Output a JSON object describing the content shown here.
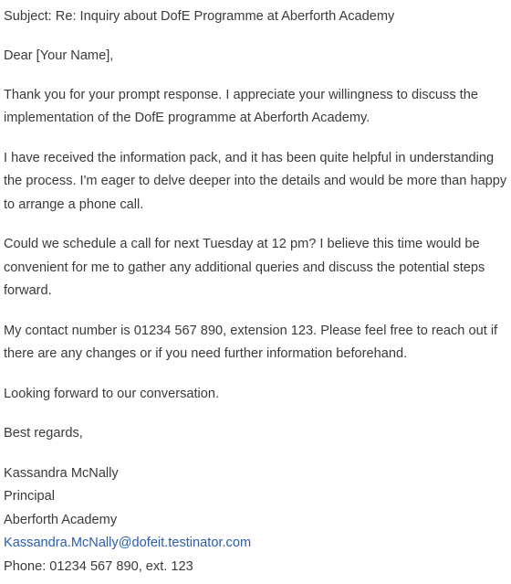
{
  "email": {
    "subject": "Subject: Re: Inquiry about DofE Programme at Aberforth Academy",
    "greeting": "Dear [Your Name],",
    "paragraphs": [
      "Thank you for your prompt response. I appreciate your willingness to discuss the implementation of the DofE programme at Aberforth Academy.",
      "I have received the information pack, and it has been quite helpful in understanding the process. I'm eager to delve deeper into the details and would be more than happy to arrange a phone call.",
      "Could we schedule a call for next Tuesday at 12 pm? I believe this time would be convenient for me to gather any additional queries and discuss the potential steps forward.",
      "My contact number is 01234 567 890, extension 123. Please feel free to reach out if there are any changes or if you need further information beforehand.",
      "Looking forward to our conversation."
    ],
    "closing": "Best regards,",
    "signature": {
      "name": "Kassandra McNally",
      "title": "Principal",
      "organization": "Aberforth Academy",
      "email": "Kassandra.McNally@dofeit.testinator.com",
      "phone": "Phone: 01234 567 890, ext. 123"
    }
  },
  "colors": {
    "text": "#3a3a3a",
    "link": "#2a5db0",
    "background": "#ffffff"
  }
}
